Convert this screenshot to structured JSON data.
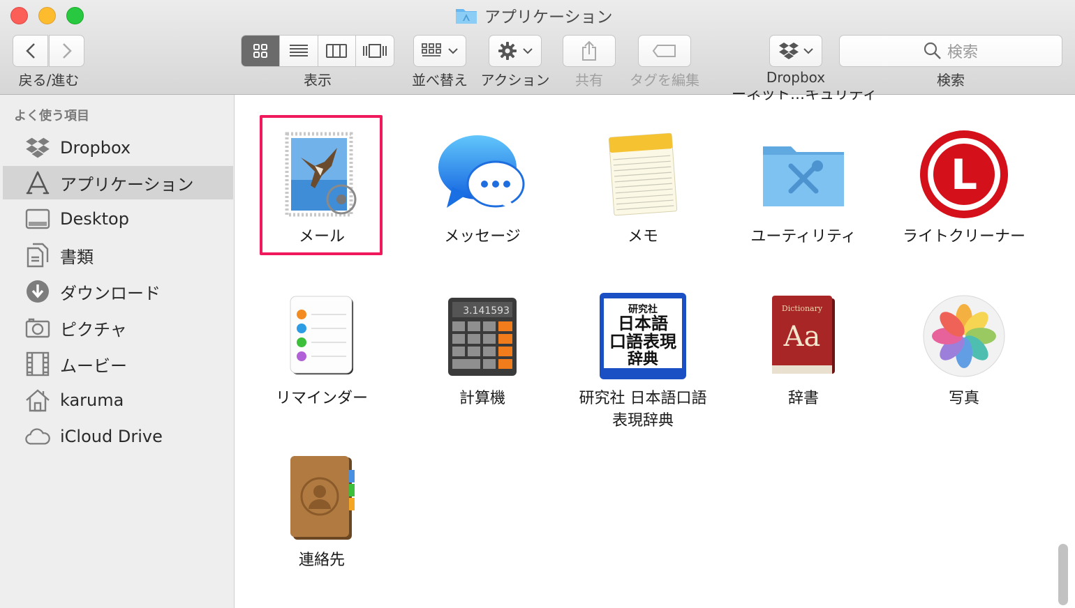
{
  "window": {
    "title": "アプリケーション"
  },
  "toolbar": {
    "nav_label": "戻る/進む",
    "view_label": "表示",
    "arrange_label": "並べ替え",
    "action_label": "アクション",
    "share_label": "共有",
    "tags_label": "タグを編集",
    "dropbox_label": "Dropbox",
    "search_label": "検索",
    "search_placeholder": "検索"
  },
  "sidebar": {
    "heading": "よく使う項目",
    "items": [
      {
        "label": "Dropbox",
        "icon": "dropbox-icon"
      },
      {
        "label": "アプリケーション",
        "icon": "applications-icon",
        "selected": true
      },
      {
        "label": "Desktop",
        "icon": "desktop-icon"
      },
      {
        "label": "書類",
        "icon": "documents-icon"
      },
      {
        "label": "ダウンロード",
        "icon": "downloads-icon"
      },
      {
        "label": "ピクチャ",
        "icon": "camera-icon"
      },
      {
        "label": "ムービー",
        "icon": "film-icon"
      },
      {
        "label": "karuma",
        "icon": "home-icon"
      },
      {
        "label": "iCloud Drive",
        "icon": "cloud-icon"
      }
    ]
  },
  "content": {
    "partial_label": "ーネット…キュリティ",
    "apps": [
      {
        "label": "メール",
        "icon": "mail-icon",
        "highlighted": true
      },
      {
        "label": "メッセージ",
        "icon": "messages-icon"
      },
      {
        "label": "メモ",
        "icon": "notes-icon"
      },
      {
        "label": "ユーティリティ",
        "icon": "utilities-folder-icon"
      },
      {
        "label": "ライトクリーナー",
        "icon": "light-cleaner-icon"
      },
      {
        "label": "リマインダー",
        "icon": "reminders-icon"
      },
      {
        "label": "計算機",
        "icon": "calculator-icon"
      },
      {
        "label": "研究社 日本語口語表現辞典",
        "icon": "kenkyusha-dictionary-icon"
      },
      {
        "label": "辞書",
        "icon": "dictionary-icon"
      },
      {
        "label": "写真",
        "icon": "photos-icon"
      },
      {
        "label": "連絡先",
        "icon": "contacts-icon"
      }
    ],
    "calculator_display": "3.141593",
    "kenkyusha_text": [
      "研究社",
      "日本語",
      "口語表現",
      "辞典"
    ],
    "dictionary_book_title": "Dictionary",
    "dictionary_book_glyph": "Aa",
    "light_cleaner_letter": "L"
  },
  "colors": {
    "highlight": "#f0195c",
    "sidebar_selected": "#d4d4d4"
  }
}
